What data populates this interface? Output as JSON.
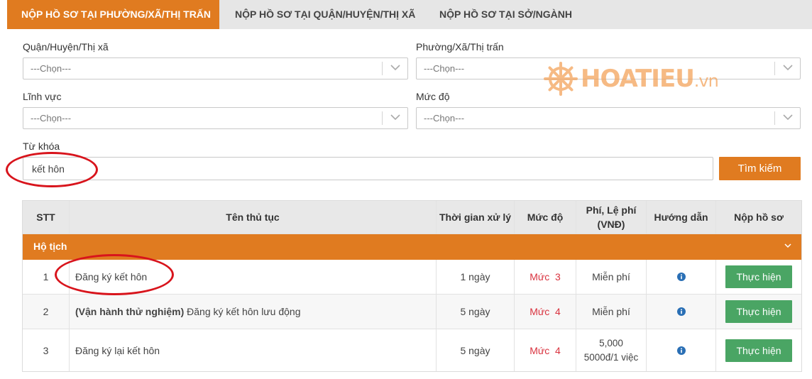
{
  "tabs": [
    {
      "label": "NỘP HỒ SƠ TẠI PHƯỜNG/XÃ/THỊ TRẤN",
      "active": true
    },
    {
      "label": "NỘP HỒ SƠ TẠI QUẬN/HUYỆN/THỊ XÃ",
      "active": false
    },
    {
      "label": "NỘP HỒ SƠ TẠI SỞ/NGÀNH",
      "active": false
    }
  ],
  "filters": {
    "district": {
      "label": "Quận/Huyện/Thị xã",
      "value": "---Chọn---"
    },
    "ward": {
      "label": "Phường/Xã/Thị trấn",
      "value": "---Chọn---"
    },
    "field": {
      "label": "Lĩnh vực",
      "value": "---Chọn---"
    },
    "level": {
      "label": "Mức độ",
      "value": "---Chọn---"
    },
    "keyword": {
      "label": "Từ khóa",
      "value": "kết hôn"
    },
    "search_label": "Tìm kiếm"
  },
  "watermark": {
    "brand": "HOATIEU",
    "suffix": ".vn"
  },
  "table": {
    "headers": {
      "stt": "STT",
      "name": "Tên thủ tục",
      "time": "Thời gian xử lý",
      "level": "Mức độ",
      "fee_line1": "Phí, Lệ phí",
      "fee_line2": "(VNĐ)",
      "guide": "Hướng dẫn",
      "submit": "Nộp hồ sơ"
    },
    "group": "Hộ tịch",
    "rows": [
      {
        "stt": "1",
        "prefix": "",
        "name": "Đăng ký kết hôn",
        "time": "1 ngày",
        "level": "Mức  3",
        "fee": "Miễn phí",
        "fee2": "",
        "action": "Thực hiện"
      },
      {
        "stt": "2",
        "prefix": "(Vận hành thử nghiệm)",
        "name": " Đăng ký kết hôn lưu động",
        "time": "5 ngày",
        "level": "Mức  4",
        "fee": "Miễn phí",
        "fee2": "",
        "action": "Thực hiện"
      },
      {
        "stt": "3",
        "prefix": "",
        "name": "Đăng ký lại kết hôn",
        "time": "5 ngày",
        "level": "Mức  4",
        "fee": "5,000",
        "fee2": "5000đ/1 việc",
        "action": "Thực hiện"
      }
    ]
  },
  "colors": {
    "accent": "#e07b20",
    "action": "#4aa564",
    "level": "#d9333f",
    "annotation": "#d8141c"
  }
}
